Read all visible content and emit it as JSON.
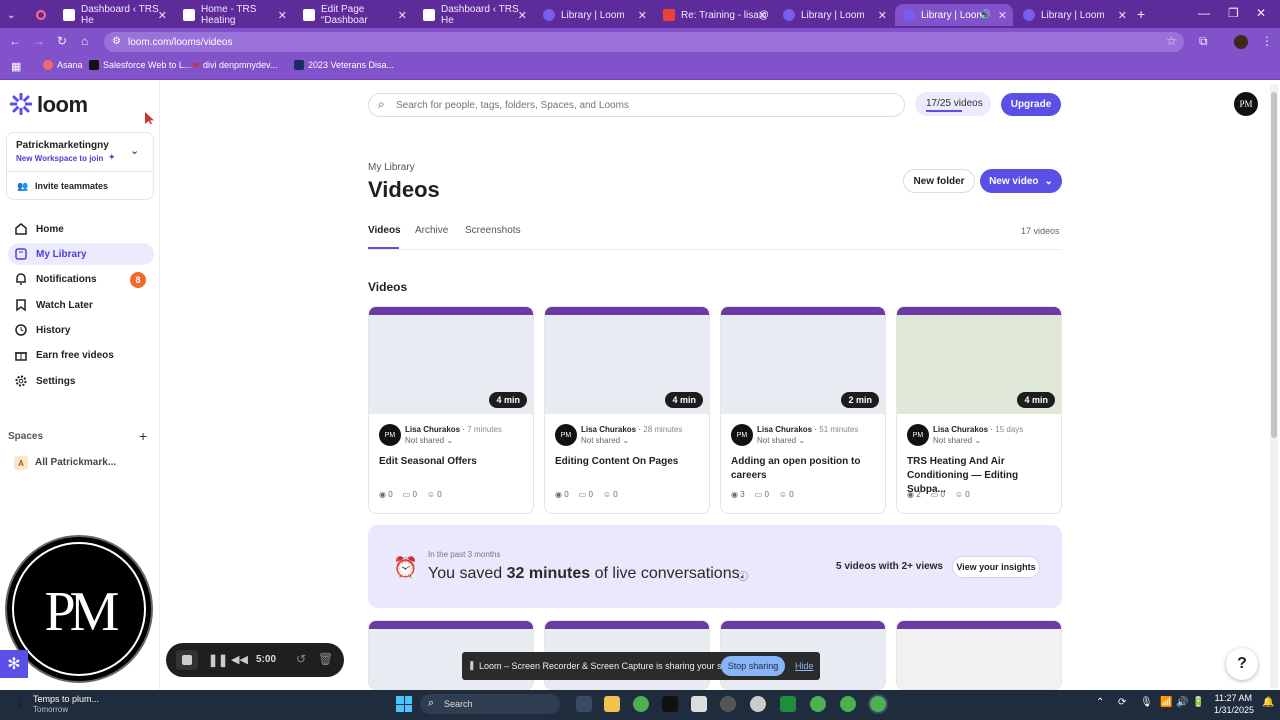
{
  "browser": {
    "tabs": [
      {
        "title": "Dashboard ‹ TRS He",
        "active": false
      },
      {
        "title": "Home - TRS Heating",
        "active": false
      },
      {
        "title": "Edit Page “Dashboar",
        "active": false
      },
      {
        "title": "Dashboard ‹ TRS He",
        "active": false
      },
      {
        "title": "Library | Loom",
        "active": false
      },
      {
        "title": "Re: Training - lisa@",
        "active": false
      },
      {
        "title": "Library | Loom",
        "active": false
      },
      {
        "title": "Library | Loom",
        "active": true
      },
      {
        "title": "Library | Loom",
        "active": false
      }
    ],
    "url": "loom.com/looms/videos",
    "bookmarks": [
      "Asana",
      "Salesforce Web to L...",
      "divi denpmnydev...",
      "2023 Veterans Disa..."
    ]
  },
  "sidebar": {
    "logo": "loom",
    "workspace_name": "Patrickmarketingny",
    "workspace_sub": "New Workspace to join",
    "invite": "Invite teammates",
    "nav": [
      {
        "label": "Home",
        "icon": "home-icon"
      },
      {
        "label": "My Library",
        "icon": "library-icon",
        "active": true
      },
      {
        "label": "Notifications",
        "icon": "bell-icon",
        "badge": "8"
      },
      {
        "label": "Watch Later",
        "icon": "bookmark-icon"
      },
      {
        "label": "History",
        "icon": "clock-icon"
      },
      {
        "label": "Earn free videos",
        "icon": "gift-icon"
      },
      {
        "label": "Settings",
        "icon": "gear-icon"
      }
    ],
    "spaces_label": "Spaces",
    "space_item_letter": "A",
    "space_item": "All Patrickmark..."
  },
  "header": {
    "search_placeholder": "Search for people, tags, folders, Spaces, and Looms",
    "video_count": "17/25 videos",
    "upgrade": "Upgrade",
    "avatar": "PM"
  },
  "main": {
    "breadcrumb": "My Library",
    "title": "Videos",
    "new_folder": "New folder",
    "new_video": "New video",
    "tabs": [
      "Videos",
      "Archive",
      "Screenshots"
    ],
    "count": "17 videos",
    "section": "Videos",
    "videos": [
      {
        "duration": "4 min",
        "author": "Lisa Churakos",
        "time": "7 minutes",
        "shared": "Not shared",
        "title": "Edit Seasonal Offers",
        "views": "0",
        "comments": "0",
        "reactions": "0"
      },
      {
        "duration": "4 min",
        "author": "Lisa Churakos",
        "time": "28 minutes",
        "shared": "Not shared",
        "title": "Editing Content On Pages",
        "views": "0",
        "comments": "0",
        "reactions": "0"
      },
      {
        "duration": "2 min",
        "author": "Lisa Churakos",
        "time": "51 minutes",
        "shared": "Not shared",
        "title": "Adding an open position to careers",
        "views": "3",
        "comments": "0",
        "reactions": "0"
      },
      {
        "duration": "4 min",
        "author": "Lisa Churakos",
        "time": "15 days",
        "shared": "Not shared",
        "title": "TRS Heating And Air Conditioning — Editing Subpa...",
        "views": "2",
        "comments": "0",
        "reactions": "0"
      }
    ],
    "insight": {
      "period": "In the past 3 months",
      "prefix": "You saved",
      "highlight": "32 minutes",
      "suffix": "of live conversations.",
      "stat": "5 videos with 2+ views",
      "button": "View your insights"
    }
  },
  "recorder": {
    "time": "5:00",
    "avatar": "PM"
  },
  "share_bar": {
    "text": "Loom – Screen Recorder & Screen Capture is sharing your screen.",
    "stop": "Stop sharing",
    "hide": "Hide"
  },
  "help": "?",
  "taskbar": {
    "weather": "Temps to plum...",
    "weather_sub": "Tomorrow",
    "search": "Search",
    "time": "11:27 AM",
    "date": "1/31/2025"
  },
  "colors": {
    "accent": "#5a4fe6",
    "chrome": "#8152c9",
    "badge": "#f06a2c"
  }
}
